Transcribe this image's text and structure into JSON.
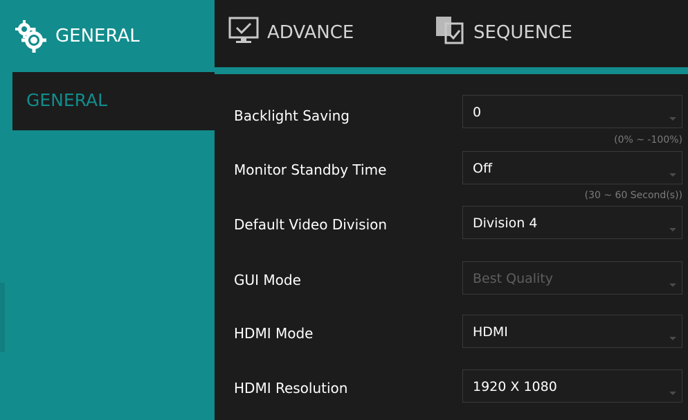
{
  "tabs": {
    "general": "GENERAL",
    "advance": "ADVANCE",
    "sequence": "SEQUENCE"
  },
  "sidebar": {
    "items": [
      {
        "label": "GENERAL"
      }
    ]
  },
  "settings": [
    {
      "label": "Backlight Saving",
      "value": "0",
      "hint": "(0% ~ -100%)",
      "enabled": true
    },
    {
      "label": "Monitor Standby Time",
      "value": "Off",
      "hint": "(30 ~ 60 Second(s))",
      "enabled": true
    },
    {
      "label": "Default Video Division",
      "value": "Division 4",
      "enabled": true
    },
    {
      "label": "GUI Mode",
      "value": "Best Quality",
      "enabled": false
    },
    {
      "label": "HDMI Mode",
      "value": "HDMI",
      "enabled": true
    },
    {
      "label": "HDMI Resolution",
      "value": "1920 X 1080",
      "enabled": true
    }
  ],
  "icons": {
    "general": "gears-icon",
    "advance": "monitor-check-icon",
    "sequence": "sequence-icon"
  },
  "colors": {
    "accent": "#128c8c",
    "background": "#1c1c1c",
    "text": "#ffffff",
    "disabled_text": "#5e5e5e",
    "hint_text": "#7b7b7b"
  }
}
